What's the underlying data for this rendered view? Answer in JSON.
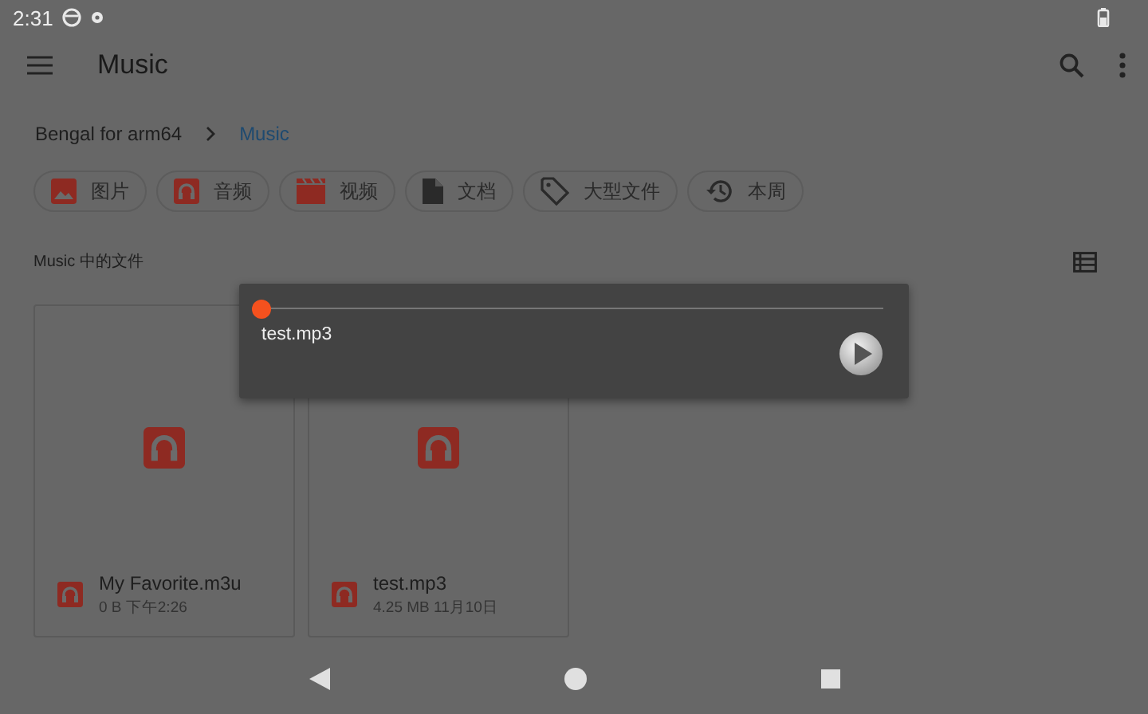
{
  "status_bar": {
    "time": "2:31"
  },
  "toolbar": {
    "title": "Music"
  },
  "breadcrumb": [
    {
      "label": "Bengal for arm64",
      "selected": false
    },
    {
      "label": "Music",
      "selected": true
    }
  ],
  "chips": [
    {
      "label": "图片",
      "kind": "image"
    },
    {
      "label": "音频",
      "kind": "audio"
    },
    {
      "label": "视频",
      "kind": "video"
    },
    {
      "label": "文档",
      "kind": "document"
    },
    {
      "label": "大型文件",
      "kind": "tag"
    },
    {
      "label": "本周",
      "kind": "history"
    }
  ],
  "section": {
    "title": "Music 中的文件"
  },
  "files": [
    {
      "name": "My Favorite.m3u",
      "details": "0 B 下午2:26"
    },
    {
      "name": "test.mp3",
      "details": "4.25 MB 11月10日"
    }
  ],
  "player": {
    "level": 0,
    "file": "test.mp3"
  }
}
